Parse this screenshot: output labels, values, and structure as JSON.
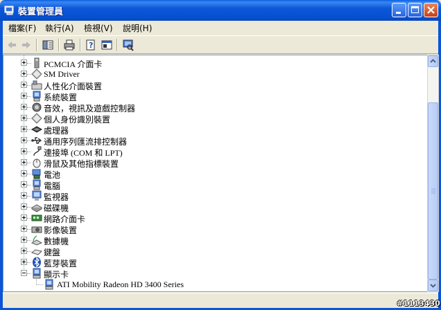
{
  "window": {
    "title": "裝置管理員"
  },
  "menu": {
    "items": [
      "檔案(F)",
      "執行(A)",
      "檢視(V)",
      "說明(H)"
    ]
  },
  "toolbar": {
    "buttons": [
      "back-arrow-icon",
      "forward-arrow-icon",
      "show-hide-tree-icon",
      "print-icon",
      "properties-icon",
      "scan-hardware-icon",
      "help-icon"
    ]
  },
  "tree": {
    "items": [
      {
        "label": "PCMCIA 介面卡",
        "icon": "pcmcia-icon"
      },
      {
        "label": "SM Driver",
        "icon": "diamond-icon"
      },
      {
        "label": "人性化介面裝置",
        "icon": "hid-icon"
      },
      {
        "label": "系統裝置",
        "icon": "computer-icon"
      },
      {
        "label": "音效，視訊及遊戲控制器",
        "icon": "sound-icon"
      },
      {
        "label": "個人身份識別裝置",
        "icon": "diamond-icon"
      },
      {
        "label": "處理器",
        "icon": "processor-icon"
      },
      {
        "label": "通用序列匯流排控制器",
        "icon": "usb-icon"
      },
      {
        "label": "連接埠 (COM 和 LPT)",
        "icon": "port-icon"
      },
      {
        "label": "滑鼠及其他指標裝置",
        "icon": "mouse-icon"
      },
      {
        "label": "電池",
        "icon": "battery-icon"
      },
      {
        "label": "電腦",
        "icon": "computer-icon"
      },
      {
        "label": "監視器",
        "icon": "monitor-icon"
      },
      {
        "label": "磁碟機",
        "icon": "disk-icon"
      },
      {
        "label": "網路介面卡",
        "icon": "network-icon"
      },
      {
        "label": "影像裝置",
        "icon": "imaging-icon"
      },
      {
        "label": "數據機",
        "icon": "modem-icon"
      },
      {
        "label": "鍵盤",
        "icon": "keyboard-icon"
      },
      {
        "label": "藍芽裝置",
        "icon": "bluetooth-icon"
      },
      {
        "label": "顯示卡",
        "icon": "display-adapter-icon",
        "expanded": true
      }
    ],
    "child": {
      "label": "ATI Mobility Radeon HD 3400 Series",
      "icon": "display-adapter-icon"
    }
  },
  "watermark": "#1113430",
  "colors": {
    "titlebar": "#0A55D8",
    "window_bg": "#ECE9D8",
    "pane_border": "#7F9DB9"
  }
}
